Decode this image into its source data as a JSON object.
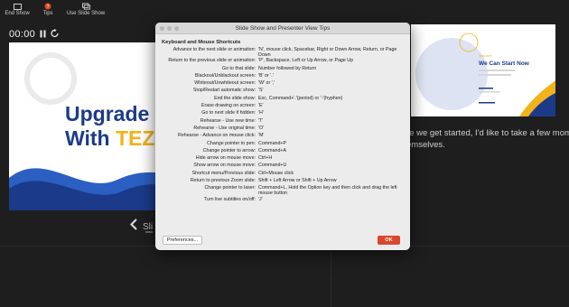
{
  "toolbar": {
    "end_show": "End Show",
    "tips": "Tips",
    "use_slide_show": "Use Slide Show"
  },
  "timer": {
    "time": "00:00"
  },
  "current_slide": {
    "title_line1": "Upgrade Y",
    "title_line2_plain": "With ",
    "title_line2_accent": "TEZIA"
  },
  "slide_nav": {
    "label": "Sli"
  },
  "next_slide": {
    "tag": "Welcome",
    "title": "We Can Start Now"
  },
  "notes": {
    "line1": "re we get started, I'd like to take a few moments ar",
    "line2": "emselves."
  },
  "dialog": {
    "title": "Slide Show and Presenter View Tips",
    "section": "Keyboard and Mouse Shortcuts",
    "rows": [
      {
        "k": "Advance to the next slide or animation:",
        "v": "'N', mouse click, Spacebar, Right or Down Arrow, Return, or Page Down"
      },
      {
        "k": "Return to the previous slide or animation:",
        "v": "'P', Backspace, Left or Up Arrow, or Page Up"
      },
      {
        "k": "Go to that slide:",
        "v": "Number followed by Return"
      },
      {
        "k": "Blackout/Unblackout screen:",
        "v": "'B' or '.'"
      },
      {
        "k": "Whiteout/Unwhiteout screen:",
        "v": "'W' or ','"
      },
      {
        "k": "Stop/Restart automatic show:",
        "v": "'S'"
      },
      {
        "k": "End the slide show:",
        "v": "Esc, Command+'.'(period) or '-'(hyphen)"
      },
      {
        "k": "Erase drawing on screen:",
        "v": "'E'"
      },
      {
        "k": "Go to next slide if hidden:",
        "v": "'H'"
      },
      {
        "k": "Rehearse - Use new time:",
        "v": "'T'"
      },
      {
        "k": "Rehearse - Use original time:",
        "v": "'O'"
      },
      {
        "k": "Rehearse - Advance on mouse click:",
        "v": "'M'"
      },
      {
        "k": "Change pointer to pen:",
        "v": "Command+P"
      },
      {
        "k": "Change pointer to arrow:",
        "v": "Command+A"
      },
      {
        "k": "Hide arrow on mouse move:",
        "v": "Ctrl+H"
      },
      {
        "k": "Show arrow on mouse move:",
        "v": "Command+U"
      },
      {
        "k": "Shortcut menu/Previous slide:",
        "v": "Ctrl+Mouse click"
      },
      {
        "k": "Return to previous Zoom slide:",
        "v": "Shift + Left Arrow or Shift + Up Arrow"
      },
      {
        "k": "Change pointer to laser:",
        "v": "Command+L, Hold the Option key and then click and drag the left mouse button"
      },
      {
        "k": "Turn live subtitles on/off:",
        "v": "'J'"
      }
    ],
    "preferences_label": "Preferences...",
    "ok_label": "OK"
  },
  "colors": {
    "brand_blue": "#1b3a8a",
    "brand_yellow": "#f2b31a",
    "ok_red": "#d9482b",
    "end_show_red": "#d9482b"
  }
}
